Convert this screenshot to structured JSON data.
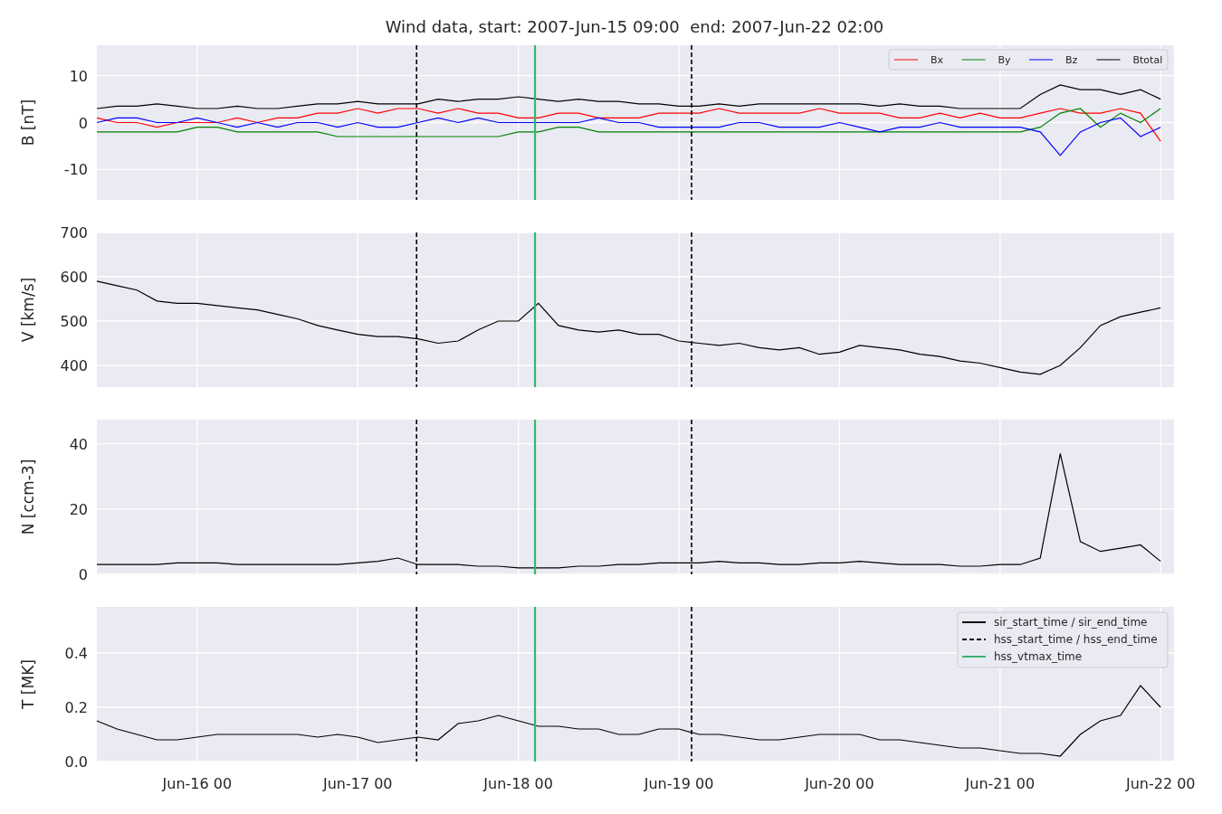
{
  "title": "Wind data, start: 2007-Jun-15 09:00  end: 2007-Jun-22 02:00",
  "panels": [
    {
      "chart_data": {
        "type": "line",
        "ylabel": "B [nT]",
        "ylim": [
          -16.5,
          16.5
        ],
        "yticks": [
          -10,
          0,
          10
        ],
        "categories": [
          null,
          null,
          null,
          null,
          null,
          null,
          null,
          null,
          null,
          null,
          null,
          null,
          null,
          null,
          null,
          null,
          null,
          null,
          null,
          null,
          null,
          null,
          null,
          null,
          null,
          null,
          null,
          null,
          null,
          null,
          null,
          null,
          null,
          null,
          null,
          null,
          null,
          null,
          null,
          null,
          null,
          null,
          null,
          null,
          null,
          null,
          null,
          null,
          null,
          null,
          null,
          null,
          null,
          null
        ],
        "series": [
          {
            "name": "Bx",
            "color": "#ff0000",
            "values": [
              1,
              0,
              0,
              -1,
              0,
              0,
              0,
              1,
              0,
              1,
              1,
              2,
              2,
              3,
              2,
              3,
              3,
              2,
              3,
              2,
              2,
              1,
              1,
              2,
              2,
              1,
              1,
              1,
              2,
              2,
              2,
              3,
              2,
              2,
              2,
              2,
              3,
              2,
              2,
              2,
              1,
              1,
              2,
              1,
              2,
              1,
              1,
              2,
              3,
              2,
              2,
              3,
              2,
              -4
            ]
          },
          {
            "name": "By",
            "color": "#008000",
            "values": [
              -2,
              -2,
              -2,
              -2,
              -2,
              -1,
              -1,
              -2,
              -2,
              -2,
              -2,
              -2,
              -3,
              -3,
              -3,
              -3,
              -3,
              -3,
              -3,
              -3,
              -3,
              -2,
              -2,
              -1,
              -1,
              -2,
              -2,
              -2,
              -2,
              -2,
              -2,
              -2,
              -2,
              -2,
              -2,
              -2,
              -2,
              -2,
              -2,
              -2,
              -2,
              -2,
              -2,
              -2,
              -2,
              -2,
              -2,
              -1,
              2,
              3,
              -1,
              2,
              0,
              3
            ]
          },
          {
            "name": "Bz",
            "color": "#0000ff",
            "values": [
              0,
              1,
              1,
              0,
              0,
              1,
              0,
              -1,
              0,
              -1,
              0,
              0,
              -1,
              0,
              -1,
              -1,
              0,
              1,
              0,
              1,
              0,
              0,
              0,
              0,
              0,
              1,
              0,
              0,
              -1,
              -1,
              -1,
              -1,
              0,
              0,
              -1,
              -1,
              -1,
              0,
              -1,
              -2,
              -1,
              -1,
              0,
              -1,
              -1,
              -1,
              -1,
              -2,
              -7,
              -2,
              0,
              1,
              -3,
              -1
            ]
          },
          {
            "name": "Btotal",
            "color": "#000000",
            "values": [
              3,
              3.5,
              3.5,
              4,
              3.5,
              3,
              3,
              3.5,
              3,
              3,
              3.5,
              4,
              4,
              4.5,
              4,
              4,
              4,
              5,
              4.5,
              5,
              5,
              5.5,
              5,
              4.5,
              5,
              4.5,
              4.5,
              4,
              4,
              3.5,
              3.5,
              4,
              3.5,
              4,
              4,
              4,
              4,
              4,
              4,
              3.5,
              4,
              3.5,
              3.5,
              3,
              3,
              3,
              3,
              6,
              8,
              7,
              7,
              6,
              7,
              5
            ]
          }
        ],
        "grid": true,
        "legend": true
      }
    },
    {
      "chart_data": {
        "type": "line",
        "ylabel": "V [km/s]",
        "ylim": [
          351,
          700
        ],
        "yticks": [
          400,
          500,
          600,
          700
        ],
        "categories": [
          null,
          null,
          null,
          null,
          null,
          null,
          null,
          null,
          null,
          null,
          null,
          null,
          null,
          null,
          null,
          null,
          null,
          null,
          null,
          null,
          null,
          null,
          null,
          null,
          null,
          null,
          null,
          null,
          null,
          null,
          null,
          null,
          null,
          null,
          null,
          null,
          null,
          null,
          null,
          null,
          null,
          null,
          null,
          null,
          null,
          null,
          null,
          null,
          null,
          null,
          null,
          null,
          null,
          null
        ],
        "series": [
          {
            "color": "#000000",
            "values": [
              590,
              580,
              570,
              545,
              540,
              540,
              535,
              530,
              525,
              515,
              505,
              490,
              480,
              470,
              465,
              465,
              460,
              450,
              455,
              480,
              500,
              500,
              540,
              490,
              480,
              475,
              480,
              470,
              470,
              455,
              450,
              445,
              450,
              440,
              435,
              440,
              425,
              430,
              445,
              440,
              435,
              425,
              420,
              410,
              405,
              395,
              385,
              380,
              400,
              440,
              490,
              510,
              520,
              530
            ]
          }
        ],
        "grid": true
      }
    },
    {
      "chart_data": {
        "type": "line",
        "ylabel": "N [ccm-3]",
        "ylim": [
          0,
          47.4
        ],
        "yticks": [
          0,
          20,
          40
        ],
        "categories": [
          null,
          null,
          null,
          null,
          null,
          null,
          null,
          null,
          null,
          null,
          null,
          null,
          null,
          null,
          null,
          null,
          null,
          null,
          null,
          null,
          null,
          null,
          null,
          null,
          null,
          null,
          null,
          null,
          null,
          null,
          null,
          null,
          null,
          null,
          null,
          null,
          null,
          null,
          null,
          null,
          null,
          null,
          null,
          null,
          null,
          null,
          null,
          null,
          null,
          null,
          null,
          null,
          null,
          null
        ],
        "series": [
          {
            "color": "#000000",
            "values": [
              3,
              3,
              3,
              3,
              3.5,
              3.5,
              3.5,
              3,
              3,
              3,
              3,
              3,
              3,
              3.5,
              4,
              5,
              3,
              3,
              3,
              2.5,
              2.5,
              2,
              2,
              2,
              2.5,
              2.5,
              3,
              3,
              3.5,
              3.5,
              3.5,
              4,
              3.5,
              3.5,
              3,
              3,
              3.5,
              3.5,
              4,
              3.5,
              3,
              3,
              3,
              2.5,
              2.5,
              3,
              3,
              5,
              37,
              10,
              7,
              8,
              9,
              4
            ]
          }
        ],
        "grid": true
      }
    },
    {
      "chart_data": {
        "type": "line",
        "ylabel": "T [MK]",
        "ylim": [
          0,
          0.57
        ],
        "yticks": [
          {
            "value": 0,
            "label": "0.0"
          },
          {
            "value": 0.2,
            "label": "0.2"
          },
          {
            "value": 0.4,
            "label": "0.4"
          }
        ],
        "categories": [
          null,
          null,
          null,
          null,
          null,
          "Jun-16 00",
          null,
          null,
          null,
          null,
          null,
          null,
          null,
          "Jun-17 00",
          null,
          null,
          null,
          null,
          null,
          null,
          null,
          "Jun-18 00",
          null,
          null,
          null,
          null,
          null,
          null,
          null,
          "Jun-19 00",
          null,
          null,
          null,
          null,
          null,
          null,
          null,
          "Jun-20 00",
          null,
          null,
          null,
          null,
          null,
          null,
          null,
          "Jun-21 00",
          null,
          null,
          null,
          null,
          null,
          null,
          null,
          "Jun-22 00"
        ],
        "series": [
          {
            "color": "#000000",
            "values": [
              0.15,
              0.12,
              0.1,
              0.08,
              0.08,
              0.09,
              0.1,
              0.1,
              0.1,
              0.1,
              0.1,
              0.09,
              0.1,
              0.09,
              0.07,
              0.08,
              0.09,
              0.08,
              0.14,
              0.15,
              0.17,
              0.15,
              0.13,
              0.13,
              0.12,
              0.12,
              0.1,
              0.1,
              0.12,
              0.12,
              0.1,
              0.1,
              0.09,
              0.08,
              0.08,
              0.09,
              0.1,
              0.1,
              0.1,
              0.08,
              0.08,
              0.07,
              0.06,
              0.05,
              0.05,
              0.04,
              0.03,
              0.03,
              0.02,
              0.1,
              0.15,
              0.17,
              0.28,
              0.2
            ]
          }
        ],
        "grid": true
      }
    }
  ],
  "events": [
    {
      "label": "sir_start_time / sir_end_time",
      "kind": "solid",
      "color": "#000000"
    },
    {
      "label": "hss_start_time / hss_end_time",
      "kind": "dashed",
      "color": "#000000"
    },
    {
      "label": "hss_vtmax_time",
      "kind": "solid",
      "color": "#3cb371"
    }
  ]
}
